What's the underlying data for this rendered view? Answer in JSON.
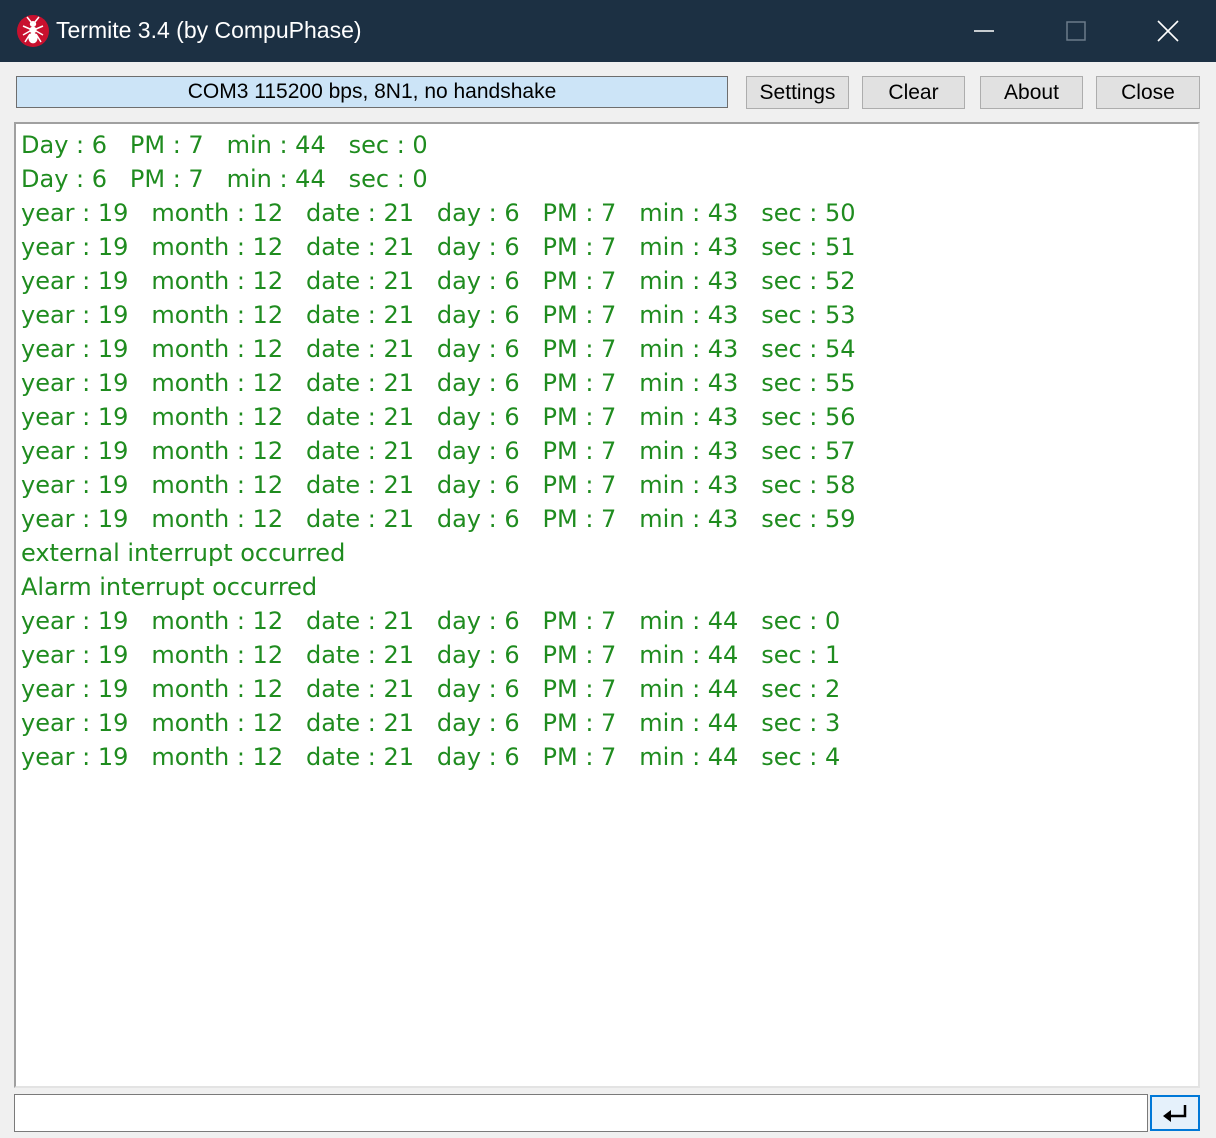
{
  "window": {
    "title": "Termite 3.4 (by CompuPhase)"
  },
  "toolbar": {
    "status": "COM3 115200 bps, 8N1, no handshake",
    "settings_label": "Settings",
    "clear_label": "Clear",
    "about_label": "About",
    "close_label": "Close"
  },
  "terminal": {
    "lines": [
      "Day : 6   PM : 7   min : 44   sec : 0",
      "Day : 6   PM : 7   min : 44   sec : 0",
      "year : 19   month : 12   date : 21   day : 6   PM : 7   min : 43   sec : 50",
      "year : 19   month : 12   date : 21   day : 6   PM : 7   min : 43   sec : 51",
      "year : 19   month : 12   date : 21   day : 6   PM : 7   min : 43   sec : 52",
      "year : 19   month : 12   date : 21   day : 6   PM : 7   min : 43   sec : 53",
      "year : 19   month : 12   date : 21   day : 6   PM : 7   min : 43   sec : 54",
      "year : 19   month : 12   date : 21   day : 6   PM : 7   min : 43   sec : 55",
      "year : 19   month : 12   date : 21   day : 6   PM : 7   min : 43   sec : 56",
      "year : 19   month : 12   date : 21   day : 6   PM : 7   min : 43   sec : 57",
      "year : 19   month : 12   date : 21   day : 6   PM : 7   min : 43   sec : 58",
      "year : 19   month : 12   date : 21   day : 6   PM : 7   min : 43   sec : 59",
      "external interrupt occurred",
      "Alarm interrupt occurred",
      "year : 19   month : 12   date : 21   day : 6   PM : 7   min : 44   sec : 0",
      "year : 19   month : 12   date : 21   day : 6   PM : 7   min : 44   sec : 1",
      "year : 19   month : 12   date : 21   day : 6   PM : 7   min : 44   sec : 2",
      "year : 19   month : 12   date : 21   day : 6   PM : 7   min : 44   sec : 3",
      "year : 19   month : 12   date : 21   day : 6   PM : 7   min : 44   sec : 4"
    ]
  },
  "input": {
    "value": ""
  },
  "icons": {
    "app": "ant-icon",
    "minimize": "minimize-icon",
    "maximize": "maximize-icon",
    "close": "close-icon",
    "send": "enter-icon"
  },
  "colors": {
    "titlebar": "#1c3043",
    "terminal_text": "#1f8c1f",
    "status_background": "#cce4f7",
    "focus_accent": "#0078d7"
  }
}
